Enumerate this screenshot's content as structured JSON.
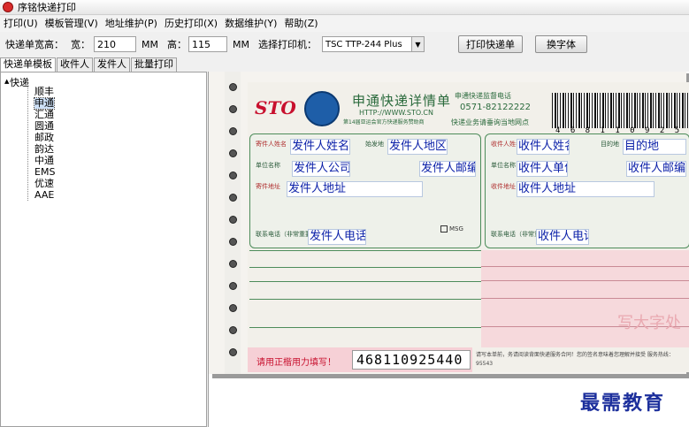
{
  "window": {
    "title": "序铭快递打印"
  },
  "menu": [
    {
      "label": "打印(U)"
    },
    {
      "label": "模板管理(V)"
    },
    {
      "label": "地址维护(P)"
    },
    {
      "label": "历史打印(X)"
    },
    {
      "label": "数据维护(Y)"
    },
    {
      "label": "帮助(Z)"
    }
  ],
  "toolbar": {
    "size_label": "快递单宽高：",
    "width_label": "宽：",
    "width_value": "210",
    "width_unit": "MM",
    "height_label": "高：",
    "height_value": "115",
    "height_unit": "MM",
    "printer_label": "选择打印机：",
    "printer_value": "TSC  TTP-244 Plus",
    "print_button": "打印快递单",
    "font_button": "换字体"
  },
  "tabs": [
    {
      "label": "快递单模板"
    },
    {
      "label": "收件人"
    },
    {
      "label": "发件人"
    },
    {
      "label": "批量打印"
    }
  ],
  "tree": {
    "root": "快递",
    "items": [
      "顺丰",
      "申通",
      "汇通",
      "圆通",
      "邮政",
      "韵达",
      "中通",
      "EMS",
      "优速",
      "AAE"
    ],
    "selected": "申通"
  },
  "waybill": {
    "logo": "STO",
    "title": "申通快递详情单",
    "url": "HTTP://WWW.STO.CN",
    "sub": "第14届亚运会官方快递服务赞助商",
    "phone_label": "申通快递监督电话",
    "phone": "0571-82122222",
    "note": "快递业务请垂询当地网点",
    "barcode_number": "4 6 8 1 1 0 9 2 5 4 4",
    "sender_labels": {
      "name": "寄件人姓名",
      "origin": "始发地",
      "company": "单位名称",
      "address": "寄件地址",
      "phone": "联系电话（非常重要）"
    },
    "recv_labels": {
      "name": "收件人姓名",
      "dest": "目的地",
      "company": "单位名称",
      "address": "收件地址",
      "phone": "联系电话（非常重要）"
    },
    "msg": "MSG",
    "bottom_label": "请用正楷用力填写！",
    "bottom_number": "468110925440",
    "bottom_text": "请写本单前，务请阅读背面快递服务合同！您的签名意味着您理解并接受 服务热线：95543",
    "pink_big": "写大字处"
  },
  "fields": {
    "sender_name": "发件人姓名",
    "sender_area": "发件人地区",
    "sender_company": "发件人公司",
    "sender_zip": "发件人邮编",
    "sender_address": "发件人地址",
    "sender_phone": "发件人电话",
    "recv_name": "收件人姓名",
    "recv_dest": "目的地",
    "recv_company": "收件人单位",
    "recv_zip": "收件人邮编",
    "recv_address": "收件人地址",
    "recv_phone": "收件人电话"
  },
  "watermark": "最需教育"
}
